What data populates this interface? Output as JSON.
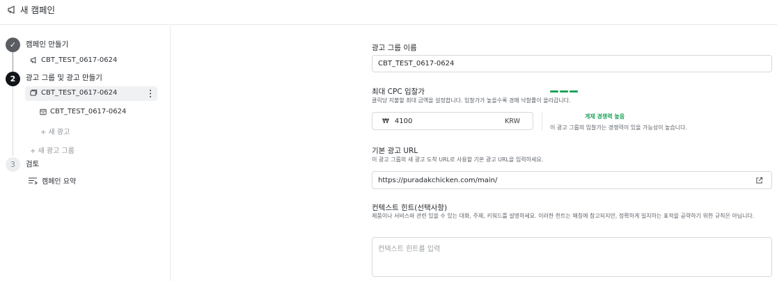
{
  "header": {
    "title": "새 캠페인",
    "icon": "megaphone-icon"
  },
  "sidebar": {
    "step1": {
      "number": "✓",
      "label": "캠페인 만들기",
      "campaign_name": "CBT_TEST_0617-0624"
    },
    "step2": {
      "number": "2",
      "label": "광고 그룹 및 광고 만들기",
      "ad_group_name": "CBT_TEST_0617-0624",
      "ad_name": "CBT_TEST_0617-0624",
      "new_ad": "+ 새 광고",
      "new_ad_group": "+ 새 광고 그룹"
    },
    "step3": {
      "number": "3",
      "label": "검토",
      "summary": "캠페인 요약"
    }
  },
  "form": {
    "ad_group_name": {
      "label": "광고 그룹 이름",
      "value": "CBT_TEST_0617-0624"
    },
    "max_cpc": {
      "label": "최대 CPC 입찰가",
      "help": "클릭당 지불할 최대 금액을 설정합니다. 입찰가가 높을수록 경매 낙찰률이 올라갑니다.",
      "currency_symbol": "₩",
      "value": "4100",
      "currency": "KRW",
      "competition_level": "게재 경쟁력 높음",
      "competition_desc": "이 광고 그룹의 입찰가는 경쟁력이 있을 가능성이 높습니다.",
      "competition_color": "#1ea45c"
    },
    "base_url": {
      "label": "기본 광고 URL",
      "help": "이 광고 그룹의 새 광고 도착 URL로 사용할 기본 광고 URL을 입력하세요.",
      "value": "https://puradakchicken.com/main/"
    },
    "context_hint": {
      "label": "컨텍스트 힌트(선택사항)",
      "help": "제품이나 서비스와 관련 있을 수 있는 대화, 주제, 키워드를 설명하세요. 이러한 힌트는 매칭에 참고되지만, 정확하게 일치하는 표적을 공략하기 위한 규칙은 아닙니다.",
      "placeholder": "컨텍스트 힌트를 입력"
    }
  }
}
